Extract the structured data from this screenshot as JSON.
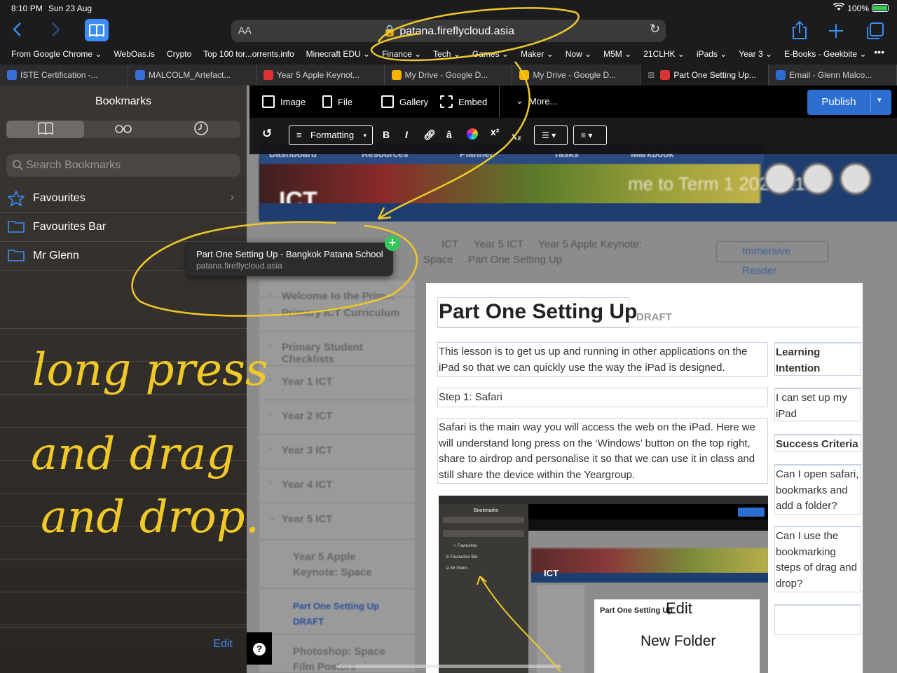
{
  "status": {
    "time": "8:10 PM",
    "date": "Sun 23 Aug",
    "battery": "100%"
  },
  "address_bar": {
    "text_size": "AA",
    "url": "patana.fireflycloud.asia"
  },
  "favourites": [
    "From Google Chrome ⌄",
    "WebOas.is",
    "Crypto",
    "Top 100 tor...orrents.info",
    "Minecraft EDU ⌄",
    "Finance ⌄",
    "Tech ⌄",
    "Games ⌄",
    "Maker ⌄",
    "Now ⌄",
    "M5M ⌄",
    "21CLHK ⌄",
    "iPads ⌄",
    "Year 3 ⌄",
    "E-Books - Geekbite ⌄"
  ],
  "tabs": [
    {
      "label": "ISTE Certification -...",
      "color": "#3b6fd8"
    },
    {
      "label": "MALCOLM_Artefact...",
      "color": "#3b6fd8"
    },
    {
      "label": "Year 5 Apple Keynot...",
      "color": "#d33"
    },
    {
      "label": "My Drive - Google D...",
      "color": "#f4b400"
    },
    {
      "label": "My Drive - Google D...",
      "color": "#f4b400"
    },
    {
      "label": "Part One Setting Up...",
      "color": "#d33"
    },
    {
      "label": "Email - Glenn Malco...",
      "color": "#2b6cd4"
    }
  ],
  "sidebar": {
    "title": "Bookmarks",
    "search_placeholder": "Search Bookmarks",
    "items": [
      {
        "label": "Favourites",
        "icon": "star-icon"
      },
      {
        "label": "Favourites Bar",
        "icon": "folder-icon"
      },
      {
        "label": "Mr Glenn",
        "icon": "folder-icon"
      }
    ],
    "edit": "Edit"
  },
  "drag_preview": {
    "title": "Part One Setting Up - Bangkok Patana School",
    "url": "patana.fireflycloud.asia",
    "badge": "+"
  },
  "handwriting": {
    "line1": "long press",
    "line2": "and drag",
    "line3": "and drop."
  },
  "editor": {
    "toolbar": {
      "image": "Image",
      "file": "File",
      "gallery": "Gallery",
      "embed": "Embed",
      "more": "More...",
      "publish": "Publish",
      "formatting": "Formatting"
    }
  },
  "page": {
    "nav": [
      "Dashboard",
      "Resources",
      "Planner",
      "Tasks",
      "Markbook"
    ],
    "banner_title": "ICT",
    "banner_text": "me to Term 1 2020/21!",
    "breadcrumb": [
      "ICT",
      "Year 5 ICT",
      "Year 5 Apple Keynote:",
      "Space",
      "Part One Setting Up"
    ],
    "immersive_reader": "Immersive Reader",
    "left_nav": [
      "Welcome to the Prim...",
      "Primary ICT Curriculum",
      "Primary Student Checklists",
      "Year 1 ICT",
      "Year 2 ICT",
      "Year 3 ICT",
      "Year 4 ICT",
      "Year 5 ICT",
      "Year 5 Apple Keynote: Space",
      "Part One Setting Up DRAFT",
      "Photoshop: Space Film Posters"
    ],
    "title": "Part One Setting Up",
    "draft": "DRAFT",
    "para1": "This lesson is to get us up and running in other applications on the iPad so that we can quickly use the way the iPad is designed.",
    "step1": "Step 1: Safari",
    "para2": "Safari is the main way you will access the web on the iPad. Here we will understand long press on the ‘Windows’ button on the top right, share to airdrop and personalise it so that we can use it in class and still share the device within the Yeargroup.",
    "learning_intention": "Learning Intention",
    "li_text": "I can set up my iPad",
    "success_criteria": "Success Criteria",
    "sc1": "Can I open safari, bookmarks and add a folder?",
    "sc2": "Can I use the bookmarking steps of drag and drop?"
  },
  "nested_shot": {
    "edit": "Edit",
    "new_folder": "New Folder",
    "bookmarks": "Bookmarks",
    "title": "Part One Setting Up",
    "ict": "ICT"
  },
  "help": "?"
}
